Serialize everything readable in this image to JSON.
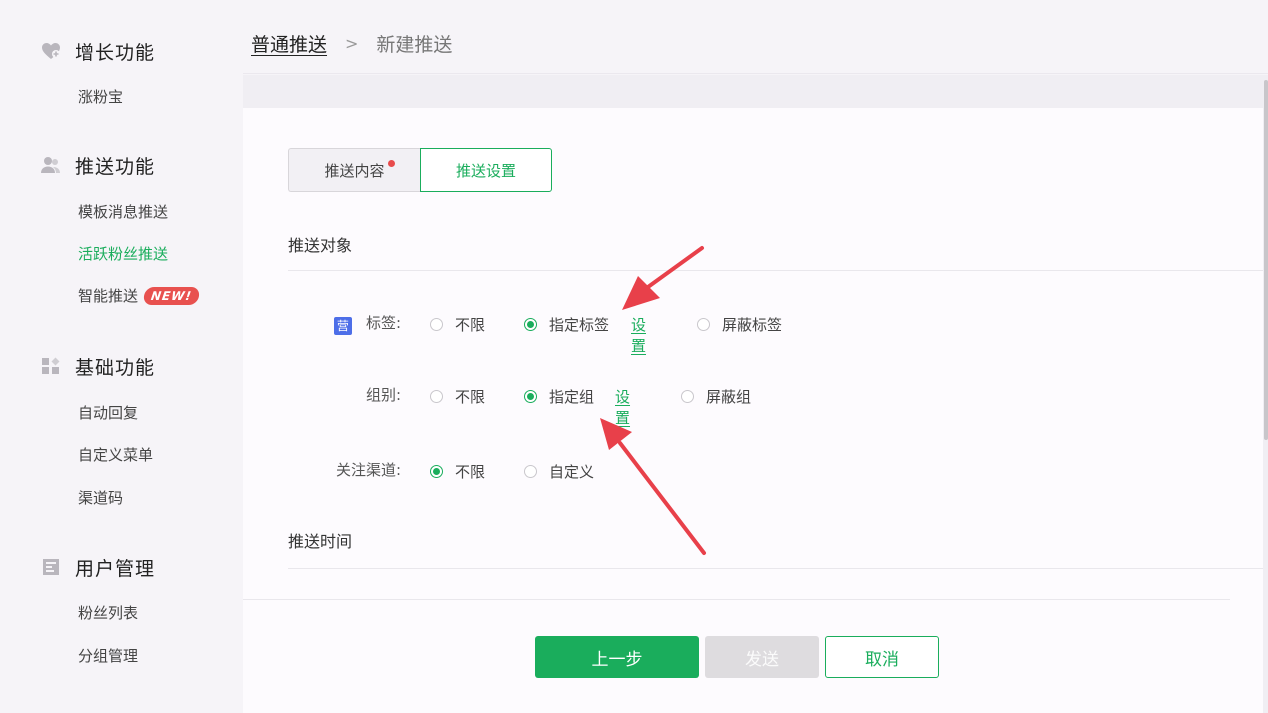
{
  "sidebar": {
    "groups": [
      {
        "title": "增长功能",
        "icon": "heart-plus-icon",
        "items": [
          {
            "label": "涨粉宝"
          }
        ]
      },
      {
        "title": "推送功能",
        "icon": "users-icon",
        "items": [
          {
            "label": "模板消息推送"
          },
          {
            "label": "活跃粉丝推送",
            "active": true
          },
          {
            "label": "智能推送",
            "badge": "NEW!"
          }
        ]
      },
      {
        "title": "基础功能",
        "icon": "grid-icon",
        "items": [
          {
            "label": "自动回复"
          },
          {
            "label": "自定义菜单"
          },
          {
            "label": "渠道码"
          }
        ]
      },
      {
        "title": "用户管理",
        "icon": "user-card-icon",
        "items": [
          {
            "label": "粉丝列表"
          },
          {
            "label": "分组管理"
          }
        ]
      }
    ]
  },
  "breadcrumb": {
    "link": "普通推送",
    "separator": ">",
    "current": "新建推送"
  },
  "tabs": [
    {
      "label": "推送内容"
    },
    {
      "label": "推送设置"
    }
  ],
  "sections": {
    "target": "推送对象",
    "time": "推送时间"
  },
  "rows": {
    "tag": {
      "icon_text": "营",
      "label": "标签:",
      "options": [
        "不限",
        "指定标签",
        "屏蔽标签"
      ],
      "selected": "指定标签",
      "link": "设置"
    },
    "group": {
      "label": "组别:",
      "options": [
        "不限",
        "指定组",
        "屏蔽组"
      ],
      "selected": "指定组",
      "link": "设置"
    },
    "channel": {
      "label": "关注渠道:",
      "options": [
        "不限",
        "自定义"
      ],
      "selected": "不限"
    }
  },
  "buttons": {
    "prev": "上一步",
    "send": "发送",
    "cancel": "取消"
  },
  "colors": {
    "accent": "#1aad5c",
    "badge": "#e8514f",
    "arrow": "#e8404a"
  }
}
